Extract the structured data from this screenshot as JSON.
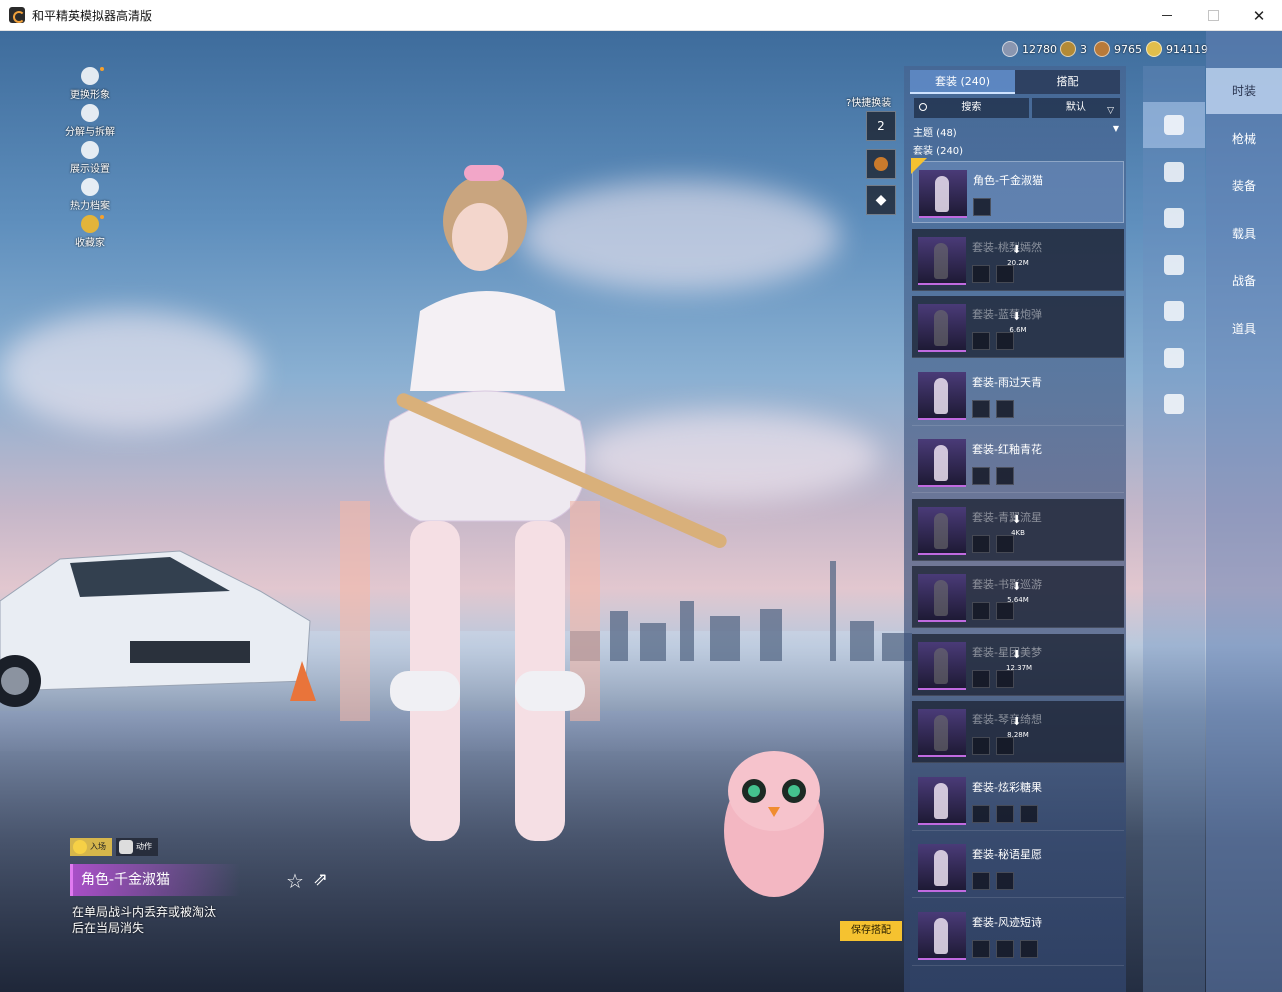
{
  "window": {
    "title": "和平精英模拟器高清版",
    "controls": {
      "minimize": "",
      "maximize": "",
      "close": "✕"
    }
  },
  "currency": [
    {
      "icon": "silver-coin-icon",
      "value": "12780"
    },
    {
      "icon": "gold-token-icon",
      "value": "3"
    },
    {
      "icon": "bronze-coin-icon",
      "value": "9765"
    },
    {
      "icon": "diamond-coin-icon",
      "value": "914119"
    }
  ],
  "left_menu": [
    {
      "label": "更换形象",
      "icon": "avatar-icon",
      "dot": true
    },
    {
      "label": "分解与拆解",
      "icon": "puzzle-icon",
      "dot": false
    },
    {
      "label": "展示设置",
      "icon": "eye-icon",
      "dot": false
    },
    {
      "label": "热力档案",
      "icon": "flame-icon",
      "dot": false
    },
    {
      "label": "收藏家",
      "icon": "collector-icon",
      "dot": true
    }
  ],
  "quick_change": {
    "label": "快捷换装",
    "slots": [
      {
        "icon": "outfit-hanger-icon",
        "text": "2"
      },
      {
        "icon": "badge-icon",
        "text": ""
      },
      {
        "icon": "diamond-icon",
        "text": ""
      }
    ]
  },
  "list": {
    "tabs": [
      {
        "label": "套装 (240)",
        "active": true
      },
      {
        "label": "搭配",
        "active": false
      }
    ],
    "search_label": "搜索",
    "sort_label": "默认",
    "theme_label": "主题 (48)",
    "suit_count": "套装 (240)",
    "items": [
      {
        "name": "角色-千金淑猫",
        "state": "selected",
        "download": "",
        "owned": true,
        "minis": 1
      },
      {
        "name": "套装-桃梨嫣然",
        "state": "dim",
        "download": "20.2M",
        "owned": false,
        "minis": 2
      },
      {
        "name": "套装-蓝莓炮弹",
        "state": "dim",
        "download": "6.6M",
        "owned": false,
        "minis": 2
      },
      {
        "name": "套装-雨过天青",
        "state": "normal",
        "download": "",
        "owned": false,
        "minis": 2
      },
      {
        "name": "套装-红釉青花",
        "state": "normal",
        "download": "",
        "owned": false,
        "minis": 2
      },
      {
        "name": "套装-青翼流星",
        "state": "dim",
        "download": "4KB",
        "owned": false,
        "minis": 2
      },
      {
        "name": "套装-书影巡游",
        "state": "dim",
        "download": "5.64M",
        "owned": false,
        "minis": 2
      },
      {
        "name": "套装-星团美梦",
        "state": "dim",
        "download": "12.37M",
        "owned": false,
        "minis": 2
      },
      {
        "name": "套装-琴音绮想",
        "state": "dim",
        "download": "8.28M",
        "owned": false,
        "minis": 2
      },
      {
        "name": "套装-炫彩糖果",
        "state": "normal",
        "download": "",
        "owned": false,
        "minis": 3
      },
      {
        "name": "套装-秘语星愿",
        "state": "normal",
        "download": "",
        "owned": false,
        "minis": 2
      },
      {
        "name": "套装-风迹短诗",
        "state": "normal",
        "download": "",
        "owned": false,
        "minis": 3
      }
    ]
  },
  "categories": [
    {
      "icon": "full-body-icon",
      "active": true
    },
    {
      "icon": "cap-icon",
      "active": false
    },
    {
      "icon": "goggles-icon",
      "active": false
    },
    {
      "icon": "mask-icon",
      "active": false
    },
    {
      "icon": "top-outfit-icon",
      "active": false
    },
    {
      "icon": "pants-icon",
      "active": false
    },
    {
      "icon": "shoes-icon",
      "active": false
    }
  ],
  "side_tabs": [
    {
      "label": "时装",
      "active": true
    },
    {
      "label": "枪械",
      "active": false
    },
    {
      "label": "装备",
      "active": false
    },
    {
      "label": "载具",
      "active": false
    },
    {
      "label": "战备",
      "active": false
    },
    {
      "label": "道具",
      "active": false
    }
  ],
  "close_label": "✕",
  "selected_item": {
    "chips": [
      {
        "label": "入场",
        "active": true
      },
      {
        "label": "动作",
        "active": false
      }
    ],
    "name": "角色-千金淑猫",
    "description": "在单局战斗内丢弃或被淘汰后在当局消失",
    "star_icon": "☆",
    "share_icon": "⇗"
  },
  "save_button": "保存搭配",
  "colors": {
    "accent_yellow": "#f5c230",
    "rarity_purple": "#c06ae0",
    "panel_blue": "#46608c"
  }
}
